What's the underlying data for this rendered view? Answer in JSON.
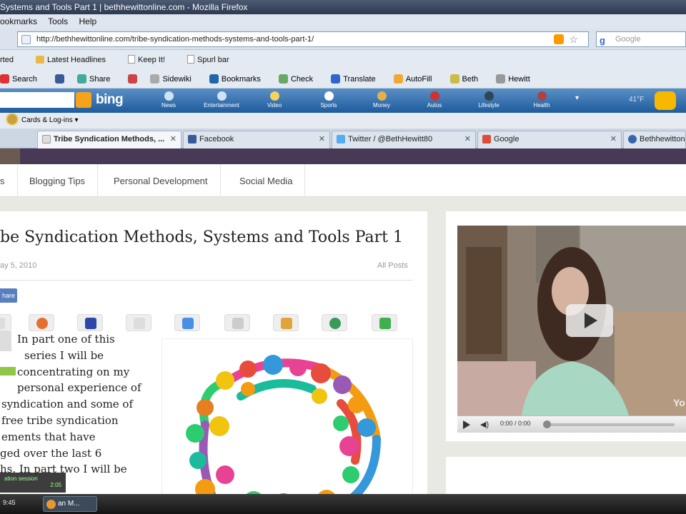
{
  "window": {
    "title": "Systems and Tools Part 1 | bethhewittonline.com - Mozilla Firefox"
  },
  "menu": {
    "items": [
      "ookmarks",
      "Tools",
      "Help"
    ]
  },
  "nav": {
    "url": "http://bethhewittonline.com/tribe-syndication-methods-systems-and-tools-part-1/",
    "search_placeholder": "Google"
  },
  "bookmarks": {
    "items": [
      "rted",
      "Latest Headlines",
      "Keep It!",
      "Spurl bar"
    ]
  },
  "toolbar": {
    "items": [
      "Search",
      "Share",
      "Sidewiki",
      "Bookmarks",
      "Check",
      "Translate",
      "AutoFill",
      "Beth",
      "Hewitt"
    ]
  },
  "bing": {
    "logo": "bing",
    "items": [
      "News",
      "Entertainment",
      "Video",
      "Sports",
      "Money",
      "Autos",
      "Lifestyle",
      "Health"
    ],
    "count": "41°F"
  },
  "cards": {
    "label": "Cards & Log-ins"
  },
  "tabs": [
    {
      "label": "Tribe Syndication Methods, ...",
      "color": "#dddddd"
    },
    {
      "label": "Facebook",
      "color": "#3b5998"
    },
    {
      "label": "Twitter / @BethHewitt80",
      "color": "#55acee"
    },
    {
      "label": "Google",
      "color": "#dd4b39"
    },
    {
      "label": "Bethhewitton",
      "color": "#3366aa"
    }
  ],
  "site_nav": {
    "items": [
      "s",
      "Blogging Tips",
      "Personal Development",
      "Social Media"
    ]
  },
  "post": {
    "title": "be Syndication Methods, Systems and Tools Part 1",
    "date": "ay 5, 2010",
    "all_posts": "All Posts",
    "share_label": "hare",
    "lines": [
      "In part one of this",
      "series I will be",
      "concentrating on my",
      "personal experience of",
      "syndication and some of",
      "free tribe syndication",
      "ements that have",
      "ged over the last 6",
      "hs. In part two I will be"
    ]
  },
  "video": {
    "time": "0:00 / 0:00",
    "brand": "Yo"
  },
  "taskbar": {
    "tray": "9:45",
    "task_label": "an M..."
  },
  "popup": {
    "line1": "ation session",
    "line2": "2:05"
  }
}
